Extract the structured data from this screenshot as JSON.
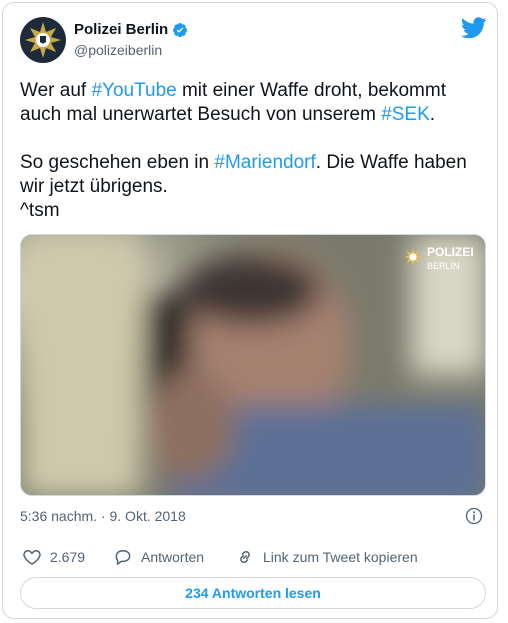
{
  "author": {
    "name": "Polizei Berlin",
    "handle": "@polizeiberlin"
  },
  "tweet": {
    "p1_a": "Wer auf ",
    "p1_tag1": "#YouTube",
    "p1_b": " mit einer Waffe droht, bekommt auch mal unerwartet Besuch von unserem ",
    "p1_tag2": "#SEK",
    "p1_c": ".",
    "p2_a": "So geschehen eben in ",
    "p2_tag": "#Mariendorf",
    "p2_b": ". Die Waffe haben wir jetzt übrigens.",
    "p3": "^tsm"
  },
  "media": {
    "watermark_title": "POLIZEI",
    "watermark_sub": "BERLIN"
  },
  "timestamp": "5:36 nachm. · 9. Okt. 2018",
  "actions": {
    "like_count": "2.679",
    "reply_label": "Antworten",
    "copy_label": "Link zum Tweet kopieren"
  },
  "read_replies_label": "234 Antworten lesen",
  "colors": {
    "accent": "#1d9bf0",
    "text": "#0f1419",
    "muted": "#536471"
  },
  "icons": [
    "police-star-icon",
    "verified-icon",
    "twitter-bird-icon",
    "info-icon",
    "heart-icon",
    "reply-bubble-icon",
    "link-icon"
  ]
}
